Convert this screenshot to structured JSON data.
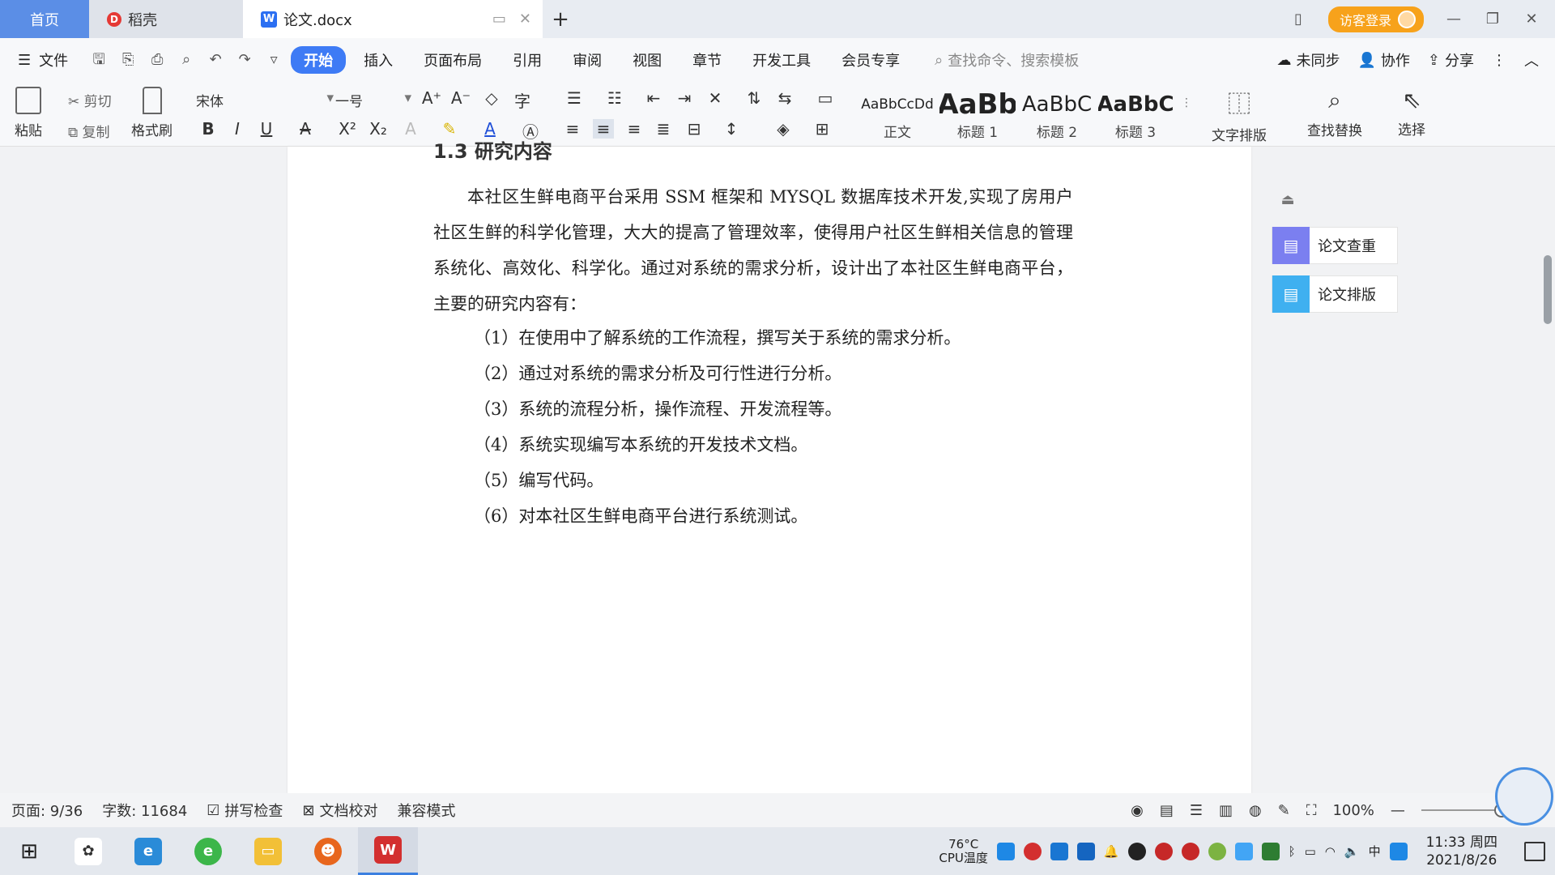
{
  "titlebar": {
    "tabs": [
      {
        "label": "首页"
      },
      {
        "label": "稻壳"
      },
      {
        "label": "论文.docx"
      }
    ],
    "guest_login": "访客登录"
  },
  "menubar": {
    "file": "文件",
    "items": [
      "开始",
      "插入",
      "页面布局",
      "引用",
      "审阅",
      "视图",
      "章节",
      "开发工具",
      "会员专享"
    ],
    "active": "开始",
    "search_placeholder": "查找命令、搜索模板",
    "sync": "未同步",
    "collab": "协作",
    "share": "分享"
  },
  "ribbon": {
    "paste": "粘贴",
    "cut": "剪切",
    "copy": "复制",
    "format_painter": "格式刷",
    "font_name": "宋体",
    "font_size": "一号",
    "styles": [
      {
        "sample": "AaBbCcDd",
        "label": "正文"
      },
      {
        "sample": "AaBb",
        "label": "标题 1"
      },
      {
        "sample": "AaBbC",
        "label": "标题 2"
      },
      {
        "sample": "AaBbC",
        "label": "标题 3"
      }
    ],
    "text_layout": "文字排版",
    "find_replace": "查找替换",
    "select": "选择"
  },
  "document": {
    "heading_partial": "1.3 研究内容",
    "paragraph": "本社区生鲜电商平台采用 SSM 框架和 MYSQL 数据库技术开发,实现了房用户社区生鲜的科学化管理，大大的提高了管理效率，使得用户社区生鲜相关信息的管理系统化、高效化、科学化。通过对系统的需求分析，设计出了本社区生鲜电商平台，主要的研究内容有：",
    "list": [
      "（1）在使用中了解系统的工作流程，撰写关于系统的需求分析。",
      "（2）通过对系统的需求分析及可行性进行分析。",
      "（3）系统的流程分析，操作流程、开发流程等。",
      "（4）系统实现编写本系统的开发技术文档。",
      "（5）编写代码。",
      "（6）对本社区生鲜电商平台进行系统测试。"
    ]
  },
  "side_panel": {
    "items": [
      {
        "label": "论文查重",
        "color": "#7b7ff0"
      },
      {
        "label": "论文排版",
        "color": "#3fb0f0"
      }
    ]
  },
  "statusbar": {
    "page": "页面: 9/36",
    "words": "字数: 11684",
    "spell_check": "拼写检查",
    "proofread": "文档校对",
    "compat_mode": "兼容模式",
    "zoom": "100%"
  },
  "taskbar": {
    "cpu_temp": "76°C",
    "cpu_label": "CPU温度",
    "ime": "中",
    "time": "11:33 周四",
    "date": "2021/8/26"
  }
}
